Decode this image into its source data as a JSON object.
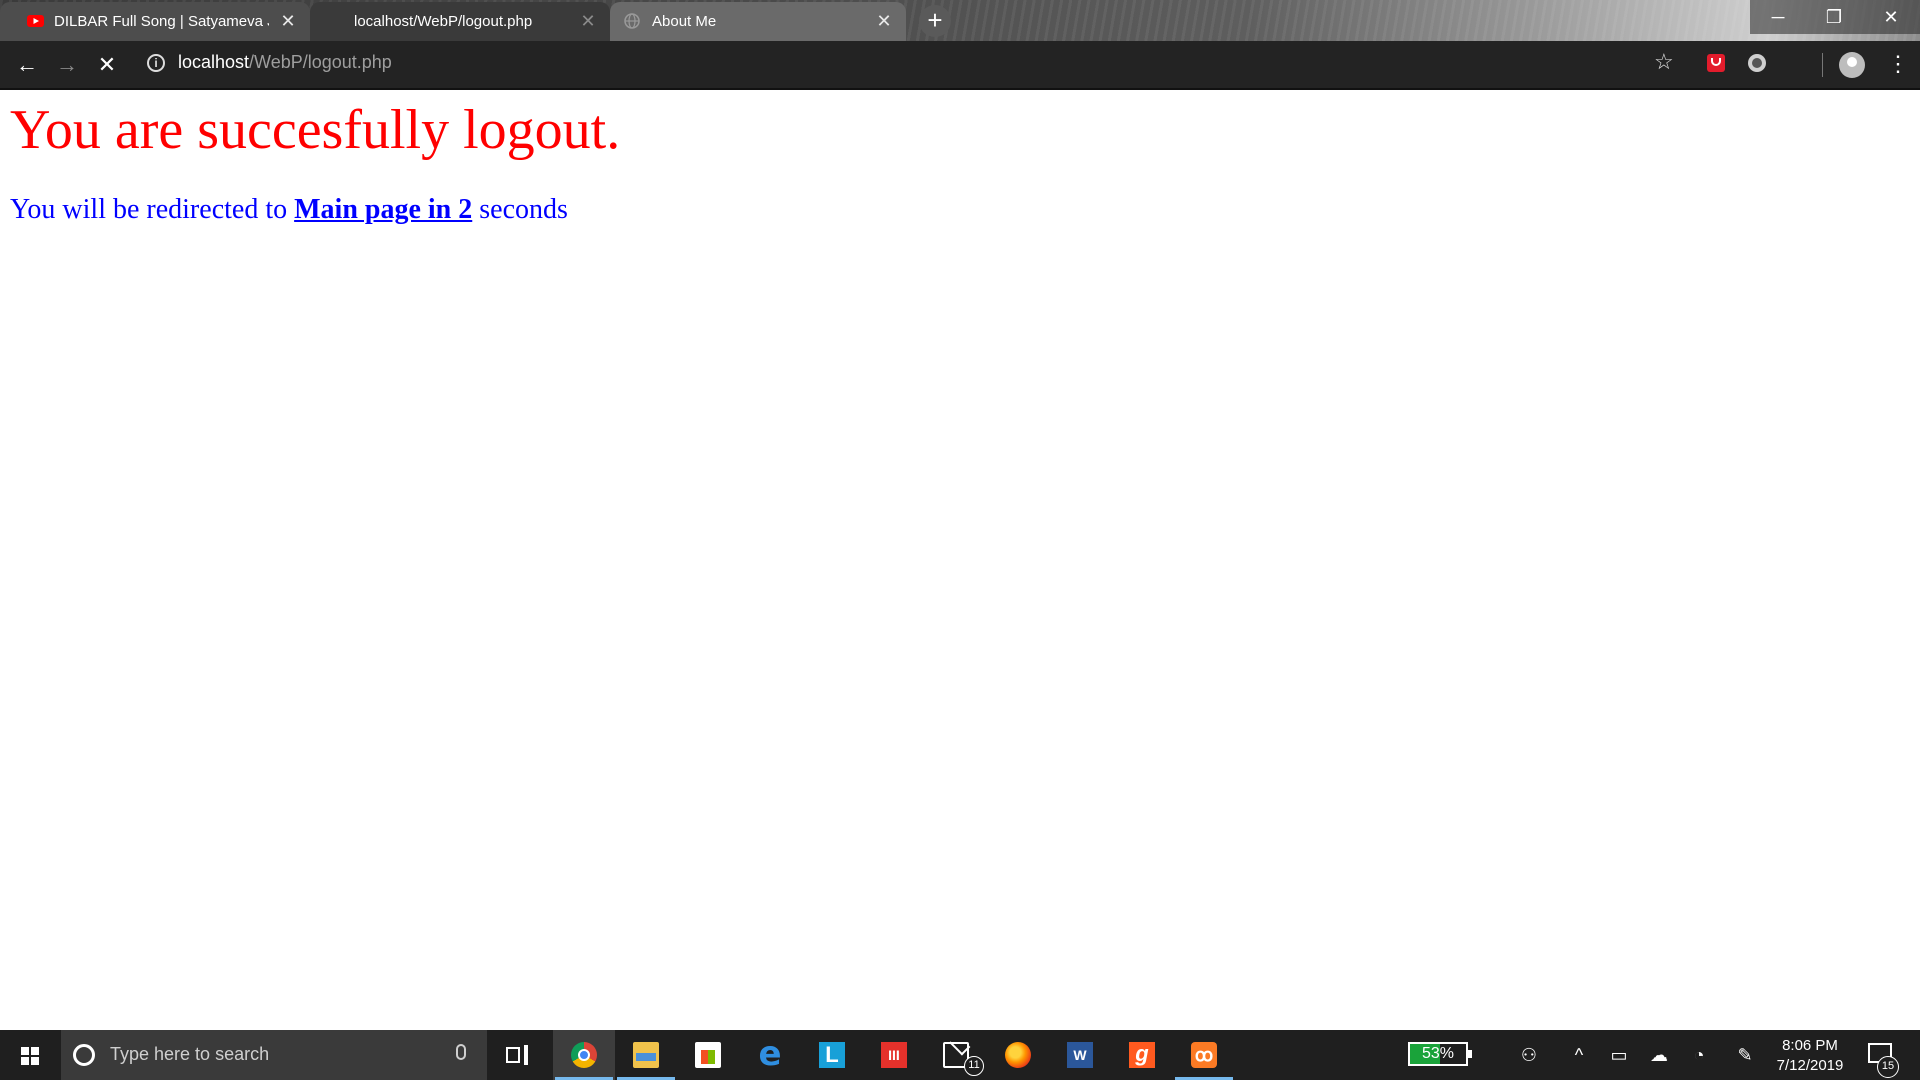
{
  "browser": {
    "tabs": [
      {
        "title": "DILBAR Full Song | Satyameva Jayate",
        "favicon": "youtube-icon"
      },
      {
        "title": "localhost/WebP/logout.php",
        "favicon": "none"
      },
      {
        "title": "About Me",
        "favicon": "globe-icon"
      }
    ],
    "address": {
      "host": "localhost",
      "path": "/WebP/logout.php"
    }
  },
  "page": {
    "headline": "You are succesfully logout.",
    "redirect_prefix": "You will be redirected to ",
    "redirect_link": "Main page in 2",
    "redirect_suffix": " seconds",
    "colors": {
      "headline": "#ff0000",
      "redirect": "#0000ff"
    }
  },
  "taskbar": {
    "search_placeholder": "Type here to search",
    "mail_badge": "11",
    "battery_label": "53%",
    "battery_level": 0.53,
    "time": "8:06 PM",
    "date": "7/12/2019",
    "notification_count": "15"
  }
}
